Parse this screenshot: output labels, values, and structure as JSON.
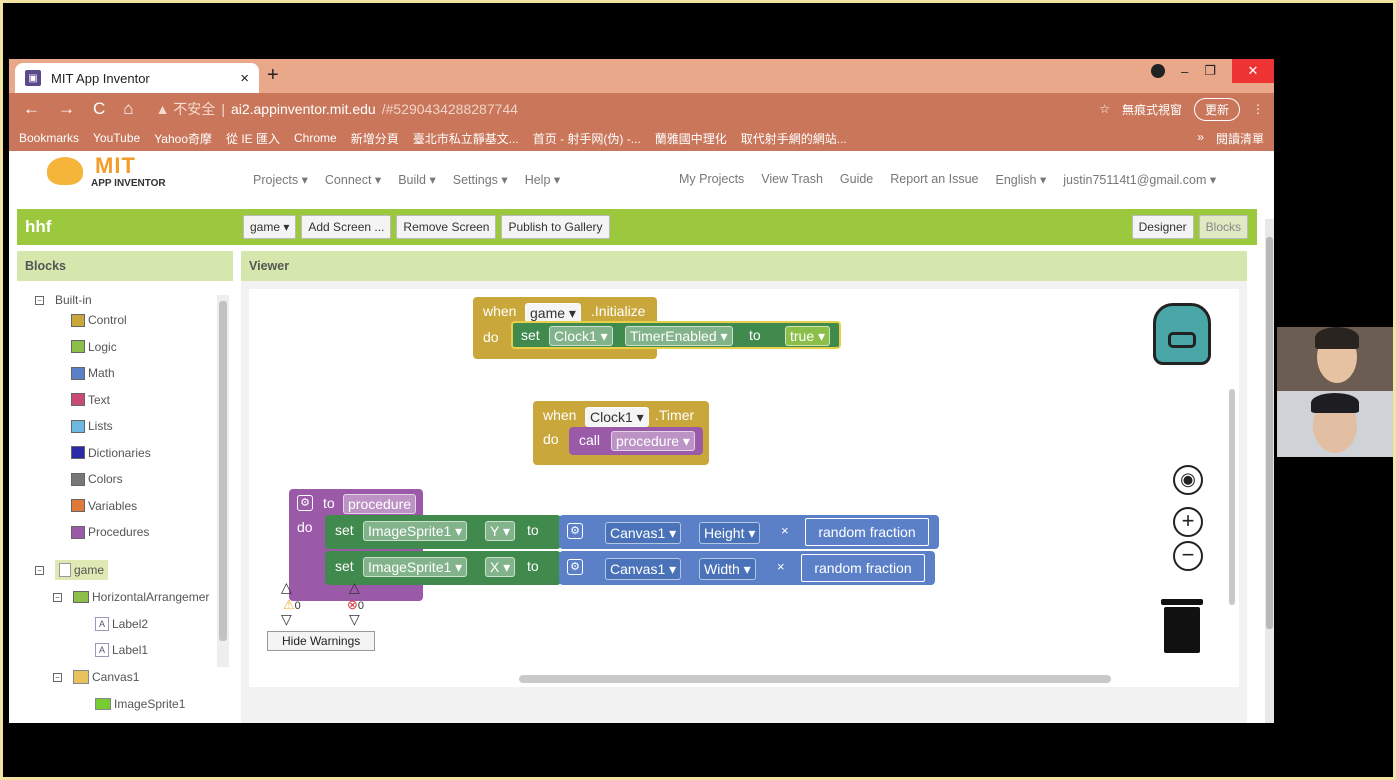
{
  "browser": {
    "tab_title": "MIT App Inventor",
    "tab_close": "×",
    "new_tab": "+",
    "nav_back": "←",
    "nav_forward": "→",
    "nav_reload": "C",
    "nav_home": "⌂",
    "security_label": "▲ 不安全",
    "url_host": "ai2.appinventor.mit.edu",
    "url_path": "/#5290434288287744",
    "incognito_label": "無痕式視窗",
    "update_label": "更新",
    "bookmarks": [
      "Bookmarks",
      "YouTube",
      "Yahoo奇摩",
      "從 IE 匯入",
      "Chrome",
      "新增分頁",
      "臺北市私立靜基文...",
      "首页 - 射手网(伪) -...",
      "蘭雅國中理化",
      "取代射手網的網站..."
    ],
    "bookmarks_more": "»",
    "reading_list": "閱讀清單",
    "win_min": "–",
    "win_max": "❐",
    "win_close": "✕"
  },
  "appinventor": {
    "logo_mit": "MIT",
    "logo_sub": "APP INVENTOR",
    "menu_left": [
      "Projects ▾",
      "Connect ▾",
      "Build ▾",
      "Settings ▾",
      "Help ▾"
    ],
    "menu_right": [
      "My Projects",
      "View Trash",
      "Guide",
      "Report an Issue",
      "English ▾",
      "justin75114t1@gmail.com ▾"
    ],
    "project_name": "hhf",
    "screen_select": "game ▾",
    "toolbar_buttons": [
      "Add Screen ...",
      "Remove Screen",
      "Publish to Gallery"
    ],
    "designer_label": "Designer",
    "blocks_label": "Blocks"
  },
  "blocks_panel": {
    "title": "Blocks",
    "builtin_label": "Built-in",
    "builtin": [
      {
        "label": "Control",
        "color": "#c9a73a"
      },
      {
        "label": "Logic",
        "color": "#8bbf4a"
      },
      {
        "label": "Math",
        "color": "#5b80c8"
      },
      {
        "label": "Text",
        "color": "#c94a72"
      },
      {
        "label": "Lists",
        "color": "#6cb8e0"
      },
      {
        "label": "Dictionaries",
        "color": "#2a2aa8"
      },
      {
        "label": "Colors",
        "color": "#777777"
      },
      {
        "label": "Variables",
        "color": "#e07a3a"
      },
      {
        "label": "Procedures",
        "color": "#9a5aa8"
      }
    ],
    "components": {
      "screen": "game",
      "arrangement": "HorizontalArrangemer",
      "label2": "Label2",
      "label1": "Label1",
      "canvas": "Canvas1",
      "sprite": "ImageSprite1"
    }
  },
  "viewer": {
    "title": "Viewer",
    "block_init": {
      "when": "when",
      "screen": "game ▾",
      "event": ".Initialize",
      "do": "do",
      "set": "set",
      "component": "Clock1 ▾",
      "prop": "TimerEnabled ▾",
      "to": "to",
      "value": "true ▾"
    },
    "block_timer": {
      "when": "when",
      "component": "Clock1 ▾",
      "event": ".Timer",
      "do": "do",
      "call": "call",
      "proc": "procedure ▾"
    },
    "block_proc": {
      "to": "to",
      "name": "procedure",
      "do": "do",
      "rows": [
        {
          "set": "set",
          "sprite": "ImageSprite1 ▾",
          "prop": "Y ▾",
          "to": "to",
          "canvas": "Canvas1 ▾",
          "cprop": "Height ▾",
          "op": "×",
          "fn": "random fraction"
        },
        {
          "set": "set",
          "sprite": "ImageSprite1 ▾",
          "prop": "X ▾",
          "to": "to",
          "canvas": "Canvas1 ▾",
          "cprop": "Width ▾",
          "op": "×",
          "fn": "random fraction"
        }
      ]
    },
    "warnings_count": "0",
    "errors_count": "0",
    "hide_warnings": "Hide Warnings"
  }
}
